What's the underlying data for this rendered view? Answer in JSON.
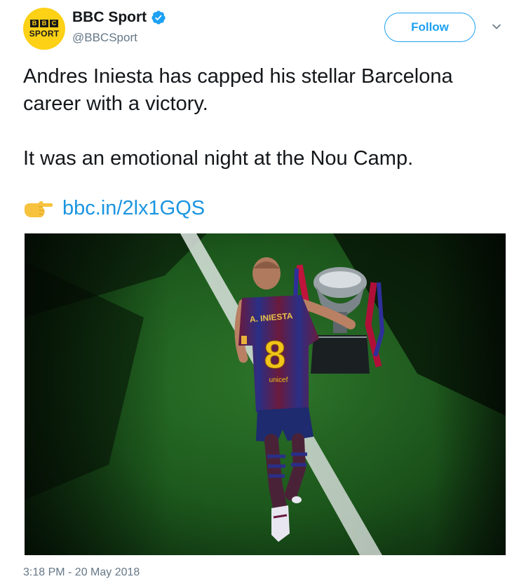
{
  "author": {
    "display_name": "BBC Sport",
    "handle": "@BBCSport",
    "avatar": {
      "logo_letters": [
        "B",
        "B",
        "C"
      ],
      "logo_word": "SPORT",
      "background": "#fcd116"
    },
    "verified": true
  },
  "actions": {
    "follow_label": "Follow",
    "menu_icon": "chevron-down-icon"
  },
  "tweet": {
    "paragraph1": "Andres Iniesta has capped his stellar Barcelona career with a victory.",
    "paragraph2": "It was an emotional night at the Nou Camp.",
    "link_emoji": "backhand-index-pointing-right-icon",
    "link_text": "bbc.in/2lx1GQS"
  },
  "media": {
    "jersey_name": "A. INIESTA",
    "jersey_number": "8",
    "sponsor": "unicef"
  },
  "timestamp": "3:18 PM - 20 May 2018",
  "colors": {
    "accent": "#1da1f2",
    "link": "#1b95e0",
    "secondary_text": "#657786",
    "verified": "#1da1f2"
  }
}
